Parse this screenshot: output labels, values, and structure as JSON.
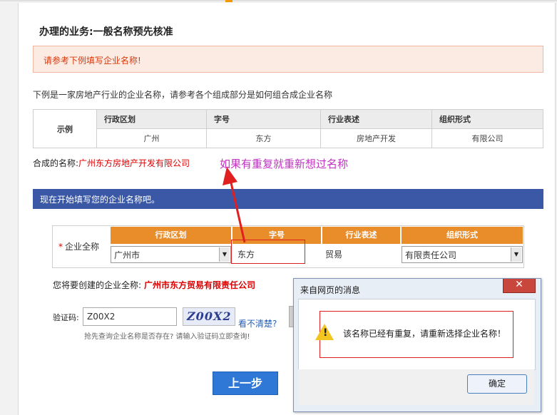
{
  "header": {
    "title": "办理的业务:一般名称预先核准"
  },
  "alert": {
    "text": "请参考下例填写企业名称!"
  },
  "intro": {
    "text": "下例是一家房地产行业的企业名称，请参考各个组成部分是如何组合成企业名称"
  },
  "example": {
    "label": "示例",
    "headers": [
      "行政区划",
      "字号",
      "行业表述",
      "组织形式"
    ],
    "values": [
      "广州",
      "东方",
      "房地产开发",
      "有限公司"
    ]
  },
  "composed": {
    "label": "合成的名称:",
    "value": "广州东方房地产开发有限公司"
  },
  "annotation": {
    "note": "如果有重复就重新想过名称"
  },
  "section": {
    "title": "现在开始填写您的企业名称吧。"
  },
  "form": {
    "required_label": "企业全称",
    "required_mark": "*",
    "headers": [
      "行政区划",
      "字号",
      "行业表述",
      "组织形式"
    ],
    "region_value": "广州市",
    "name_value": "东方",
    "industry_value": "贸易",
    "org_value": "有限责任公司"
  },
  "full_name": {
    "label": "您将要创建的企业全称:",
    "value": "广州市东方贸易有限责任公司"
  },
  "captcha": {
    "label": "验证码:",
    "input_value": "Z00X2",
    "image_text": "Z00X2",
    "refresh_text": "看不清楚?",
    "hint": "抢先查询企业名称是否存在? 请输入验证码立即查询!"
  },
  "buttons": {
    "prev": "上一步"
  },
  "dialog": {
    "title": "来自网页的消息",
    "close": "✕",
    "message": "该名称已经有重复，请重新选择企业名称！",
    "ok": "确定",
    "warn_mark": "!"
  },
  "colors": {
    "accent_orange": "#e98c2a",
    "bar_blue": "#3a58a6",
    "alert_red": "#d9380b",
    "note_purple": "#c033c0",
    "annotation_red": "#e02020"
  }
}
